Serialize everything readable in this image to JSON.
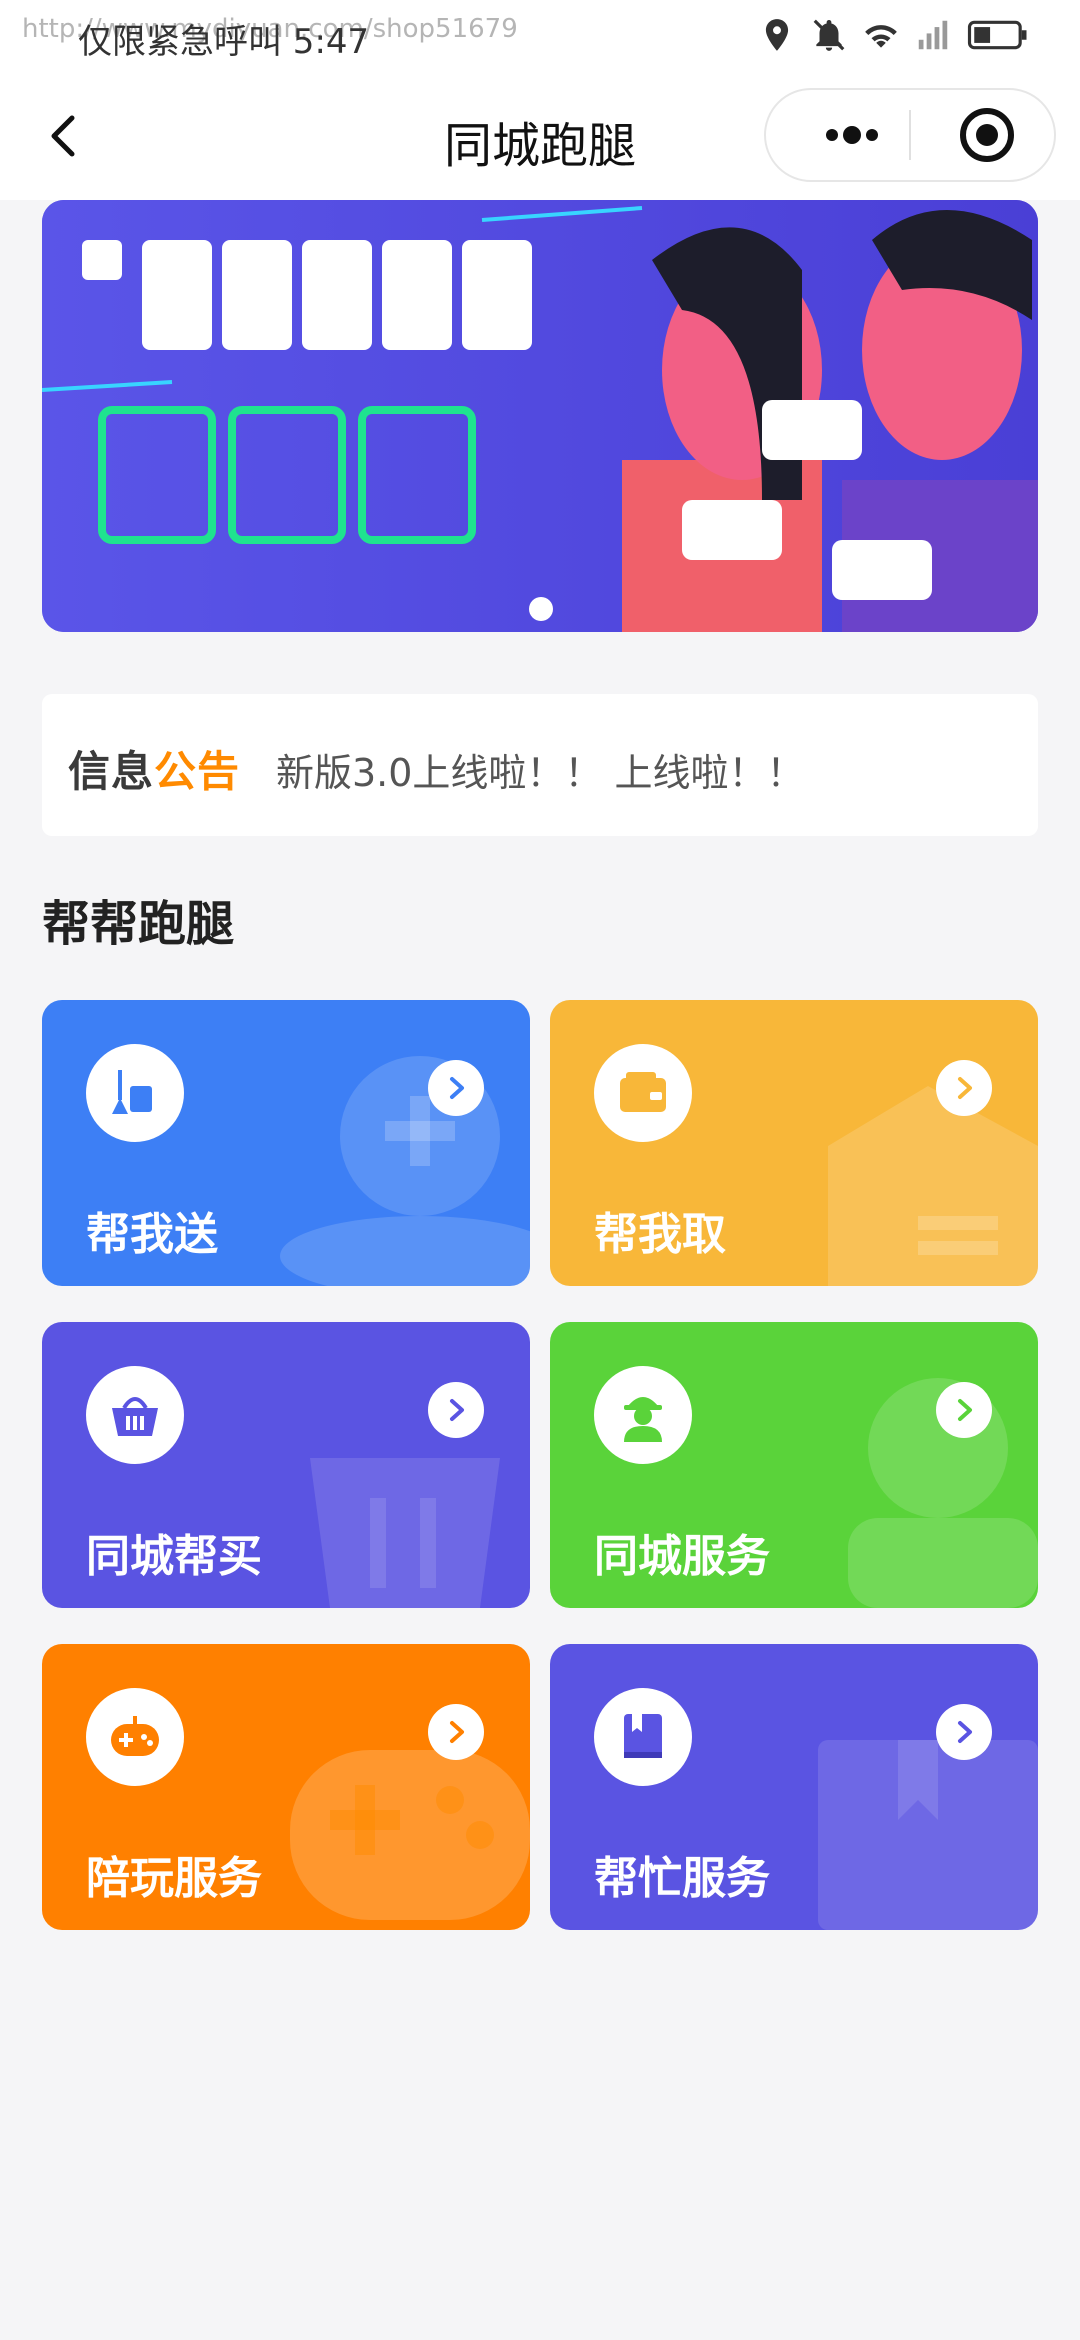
{
  "status_bar": {
    "left_text": "仅限紧急呼叫 5:47",
    "watermark": "http://www.mydiyuan.com/shop51679"
  },
  "nav": {
    "title": "同城跑腿"
  },
  "notice": {
    "tag_part1": "信息",
    "tag_part2": "公告",
    "text": "新版3.0上线啦！！ 上线啦！！"
  },
  "section": {
    "title": "帮帮跑腿"
  },
  "services": [
    {
      "label": "帮我送",
      "color": "#3d7ff5",
      "icon": "broom-cup-icon"
    },
    {
      "label": "帮我取",
      "color": "#f8b739",
      "icon": "wallet-icon"
    },
    {
      "label": "同城帮买",
      "color": "#5a54e2",
      "icon": "basket-icon"
    },
    {
      "label": "同城服务",
      "color": "#5ad33a",
      "icon": "worker-icon"
    },
    {
      "label": "陪玩服务",
      "color": "#ff8000",
      "icon": "gamepad-icon"
    },
    {
      "label": "帮忙服务",
      "color": "#5a54e2",
      "icon": "book-icon"
    }
  ]
}
